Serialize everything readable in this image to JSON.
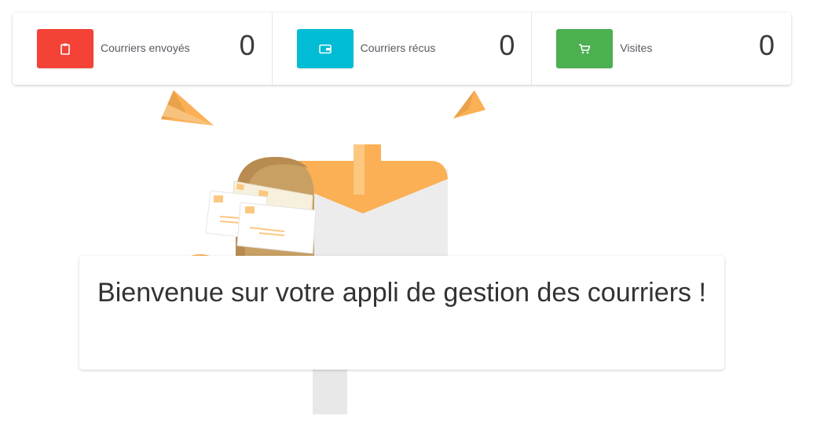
{
  "stats": [
    {
      "label": "Courriers envoyés",
      "count": "0",
      "icon": "clipboard-icon",
      "color": "#f44336"
    },
    {
      "label": "Courriers récus",
      "count": "0",
      "icon": "wallet-icon",
      "color": "#00bcd4"
    },
    {
      "label": "Visites",
      "count": "0",
      "icon": "cart-icon",
      "color": "#4caf50"
    }
  ],
  "welcome": {
    "message": "Bienvenue sur votre appli de gestion des courriers !"
  },
  "illustration": {
    "accent_color": "#fbb055",
    "mailbox_door_color": "#c8a064",
    "name": "mailbox-illustration"
  }
}
